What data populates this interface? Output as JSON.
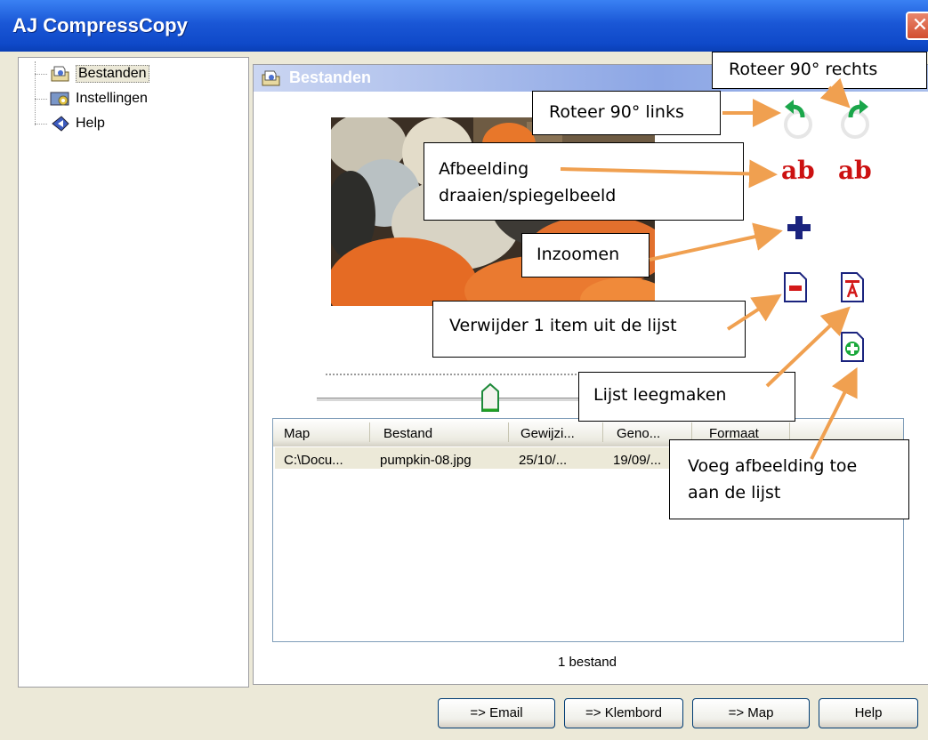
{
  "window": {
    "title": "AJ CompressCopy",
    "close_glyph": "✕"
  },
  "tree": {
    "items": [
      {
        "label": "Bestanden",
        "icon": "files-icon"
      },
      {
        "label": "Instellingen",
        "icon": "settings-icon"
      },
      {
        "label": "Help",
        "icon": "help-icon"
      }
    ]
  },
  "panel": {
    "title": "Bestanden"
  },
  "list": {
    "columns": [
      "Map",
      "Bestand",
      "Gewijzi...",
      "Geno...",
      "Formaat"
    ],
    "rows": [
      {
        "map": "C:\\Docu...",
        "bestand": "pumpkin-08.jpg",
        "gewijzigd": "25/10/...",
        "genomen": "19/09/..."
      }
    ]
  },
  "status": "1 bestand",
  "buttons": {
    "email": "=> Email",
    "klembord": "=> Klembord",
    "map": "=> Map",
    "help": "Help"
  },
  "tools": {
    "mirror_text": "ab"
  },
  "callouts": {
    "rotate_right": "Roteer 90° rechts",
    "rotate_left": "Roteer 90° links",
    "flip_line1": "Afbeelding",
    "flip_line2": "draaien/spiegelbeeld",
    "zoom": "Inzoomen",
    "remove": "Verwijder 1 item uit de lijst",
    "clear": "Lijst leegmaken",
    "add_line1": "Voeg afbeelding toe",
    "add_line2": "aan de lijst"
  },
  "colors": {
    "callout_arrow": "#F0A050",
    "titlebar": "#0F49C9",
    "mirror_text": "#CC1111",
    "zoom_plus": "#1A237E"
  }
}
